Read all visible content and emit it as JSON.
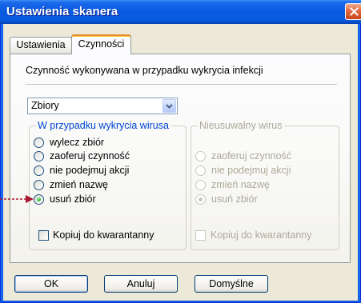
{
  "window": {
    "title": "Ustawienia skanera"
  },
  "tabs": [
    {
      "label": "Ustawienia",
      "selected": false
    },
    {
      "label": "Czynności",
      "selected": true
    }
  ],
  "actions_tab": {
    "heading": "Czynność wykonywana w przypadku wykrycia infekcji",
    "object_type_select": {
      "value": "Zbiory"
    },
    "virus_group": {
      "title": "W przypadku wykrycia wirusa",
      "enabled": true,
      "options": [
        {
          "label": "wylecz zbiór",
          "selected": false
        },
        {
          "label": "zaoferuj czynność",
          "selected": false
        },
        {
          "label": "nie podejmuj akcji",
          "selected": false
        },
        {
          "label": "zmień nazwę",
          "selected": false
        },
        {
          "label": "usuń zbiór",
          "selected": true
        }
      ],
      "quarantine_checkbox": {
        "label": "Kopiuj do kwarantanny",
        "checked": false
      }
    },
    "incurable_group": {
      "title": "Nieusuwalny wirus",
      "enabled": false,
      "options": [
        {
          "label": "zaoferuj czynność",
          "selected": false
        },
        {
          "label": "nie podejmuj akcji",
          "selected": false
        },
        {
          "label": "zmień nazwę",
          "selected": false
        },
        {
          "label": "usuń zbiór",
          "selected": true
        }
      ],
      "quarantine_checkbox": {
        "label": "Kopiuj do kwarantanny",
        "checked": false
      }
    }
  },
  "buttons": {
    "ok": "OK",
    "cancel": "Anuluj",
    "defaults": "Domyślne"
  },
  "icons": {
    "close": "close-icon",
    "dropdown": "chevron-down-icon",
    "annotation": "arrow-right-icon"
  },
  "colors": {
    "title_bar": "#0A5AE0",
    "title_text": "#FFFFFF",
    "selected_tab_accent": "#E68B2C",
    "group_caption": "#0046D5",
    "disabled_text": "#ACA899",
    "radio_selected": "#21A121",
    "annotation_arrow": "#A81830"
  }
}
